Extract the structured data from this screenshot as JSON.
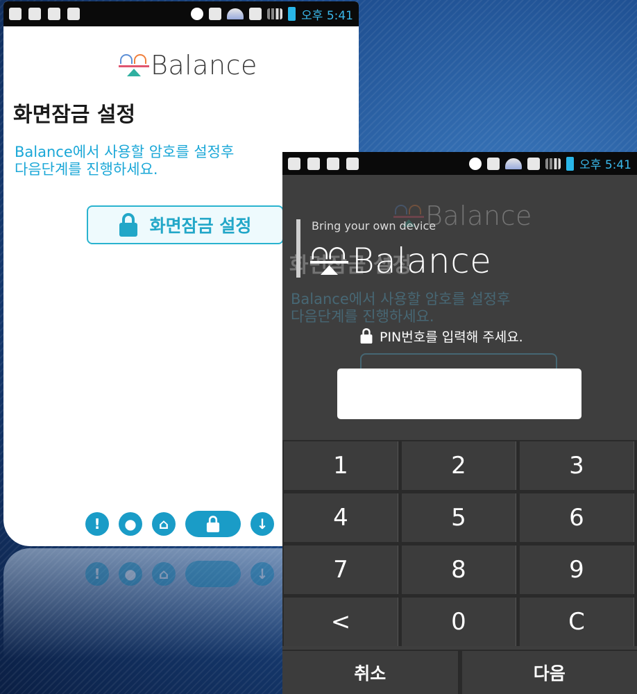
{
  "status_bar": {
    "time": "오후 5:41"
  },
  "setup_screen": {
    "logo": "Balance",
    "title": "화면잠금 설정",
    "description": "Balance에서 사용할 암호를 설정후\n다음단계를 진행하세요.",
    "lock_button_label": "화면잠금 설정",
    "nav_icons": [
      "info-icon",
      "user-icon",
      "home-icon",
      "lock-icon",
      "download-icon"
    ]
  },
  "pin_screen": {
    "subtitle": "Bring your own device",
    "logo": "Balance",
    "prompt": "PIN번호를 입력해 주세요.",
    "pin_value": "",
    "keys": [
      "1",
      "2",
      "3",
      "4",
      "5",
      "6",
      "7",
      "8",
      "9",
      "<",
      "0",
      "C"
    ],
    "cancel_label": "취소",
    "next_label": "다음"
  },
  "colors": {
    "accent": "#1aa7d7",
    "pin_background": "#3e3e3e"
  }
}
